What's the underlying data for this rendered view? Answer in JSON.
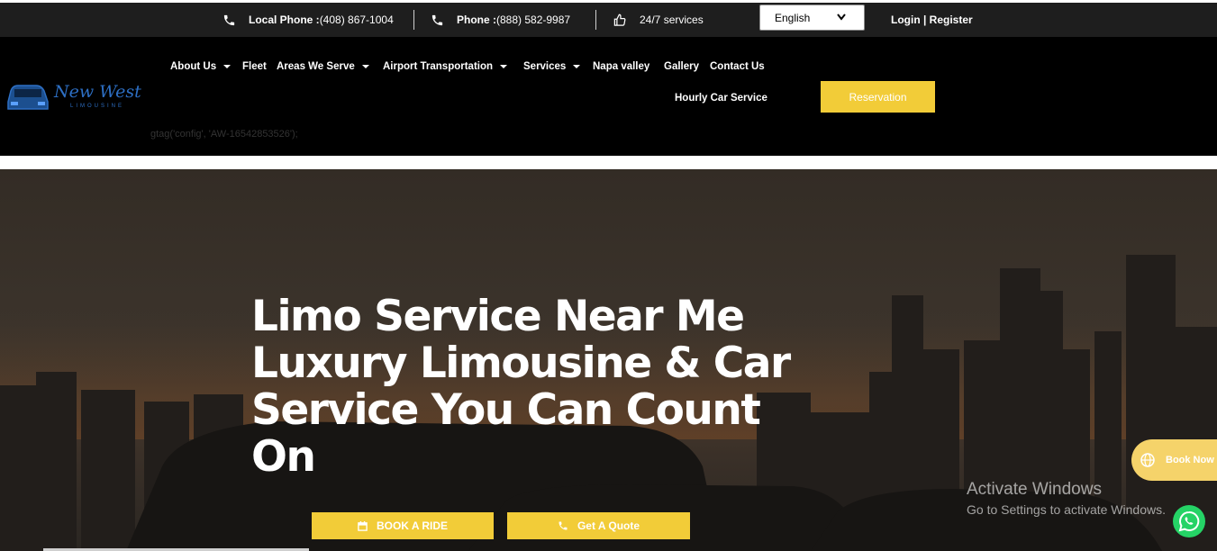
{
  "topbar": {
    "local_phone_label": "Local Phone :",
    "local_phone_number": " (408) 867-1004",
    "phone_label": "Phone :",
    "phone_number": " (888) 582-9987",
    "services_text": "24/7 services",
    "language_selected": "English",
    "login_register": "Login | Register"
  },
  "header": {
    "logo_text": "New West",
    "logo_subtext": "LIMOUSINE",
    "nav": [
      {
        "label": "About Us"
      },
      {
        "label": "Fleet"
      },
      {
        "label": "Areas We Serve"
      },
      {
        "label": "Airport Transportation"
      },
      {
        "label": "Services"
      },
      {
        "label": "Napa valley"
      },
      {
        "label": "Gallery"
      },
      {
        "label": "Contact Us"
      },
      {
        "label": "Hourly Car Service"
      }
    ],
    "reservation_label": "Reservation",
    "gtag_text": "gtag('config', 'AW-16542853526');"
  },
  "hero": {
    "headline": "Limo Service Near Me Luxury Limousine & Car Service You Can Count On",
    "book_ride_label": "BOOK A RIDE",
    "get_quote_label": "Get A Quote",
    "book_now_label": "Book Now"
  },
  "windows_watermark": {
    "title": "Activate Windows",
    "subtitle": "Go to Settings to activate Windows."
  },
  "colors": {
    "accent": "#f2cc38",
    "topbar_bg": "#1e1e1e",
    "header_bg": "#000000",
    "whatsapp": "#25d366"
  },
  "icons": [
    "phone-icon",
    "thumbs-up-icon",
    "chevron-down-icon",
    "calendar-icon",
    "globe-icon",
    "whatsapp-icon"
  ]
}
